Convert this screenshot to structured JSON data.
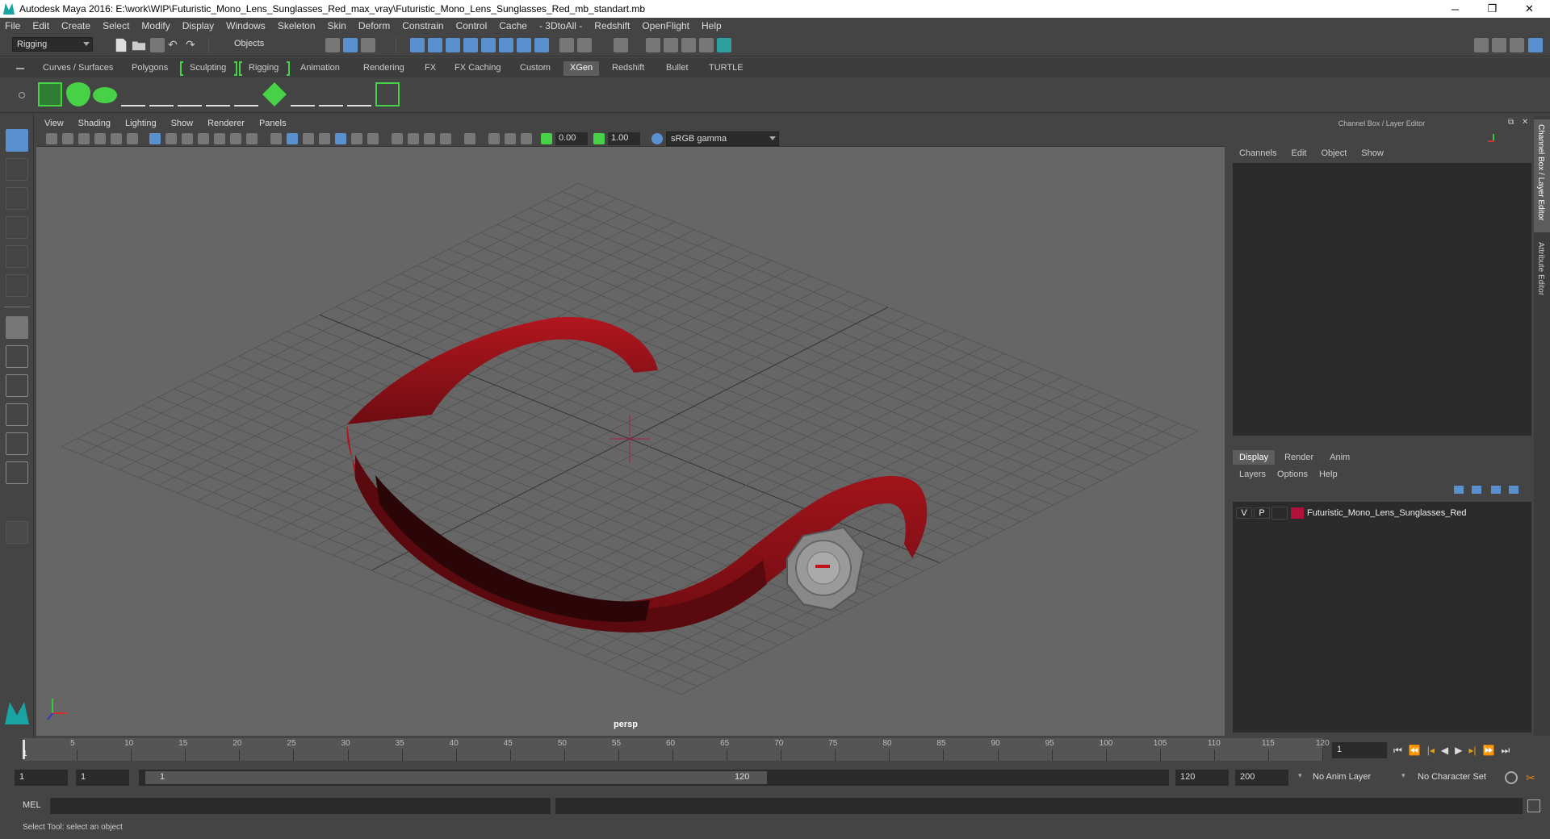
{
  "window": {
    "title": "Autodesk Maya 2016: E:\\work\\WIP\\Futuristic_Mono_Lens_Sunglasses_Red_max_vray\\Futuristic_Mono_Lens_Sunglasses_Red_mb_standart.mb",
    "minimize": "─",
    "restore": "❐",
    "close": "✕"
  },
  "menubar": [
    "File",
    "Edit",
    "Create",
    "Select",
    "Modify",
    "Display",
    "Windows",
    "Skeleton",
    "Skin",
    "Deform",
    "Constrain",
    "Control",
    "Cache",
    "- 3DtoAll -",
    "Redshift",
    "OpenFlight",
    "Help"
  ],
  "statusline": {
    "mode": "Rigging",
    "selection_mode": "Objects"
  },
  "shelf_tabs": [
    "Curves / Surfaces",
    "Polygons",
    "Sculpting",
    "Rigging",
    "Animation",
    "Rendering",
    "FX",
    "FX Caching",
    "Custom",
    "XGen",
    "Redshift",
    "Bullet",
    "TURTLE"
  ],
  "shelf_active_tab": "XGen",
  "viewport": {
    "menu": [
      "View",
      "Shading",
      "Lighting",
      "Show",
      "Renderer",
      "Panels"
    ],
    "exposure": "0.00",
    "gamma": "1.00",
    "color_space": "sRGB gamma",
    "camera_label": "persp"
  },
  "channel_box": {
    "title": "Channel Box / Layer Editor",
    "menu": [
      "Channels",
      "Edit",
      "Object",
      "Show"
    ]
  },
  "layer_editor": {
    "tabs": [
      "Display",
      "Render",
      "Anim"
    ],
    "active_tab": "Display",
    "menu": [
      "Layers",
      "Options",
      "Help"
    ],
    "layers": [
      {
        "v": "V",
        "p": "P",
        "name": "Futuristic_Mono_Lens_Sunglasses_Red",
        "color": "#b0123a"
      }
    ]
  },
  "side_tabs": [
    "Channel Box / Layer Editor",
    "Attribute Editor"
  ],
  "timeline": {
    "ticks": [
      "5",
      "10",
      "15",
      "20",
      "25",
      "30",
      "35",
      "40",
      "45",
      "50",
      "55",
      "60",
      "65",
      "70",
      "75",
      "80",
      "85",
      "90",
      "95",
      "100",
      "105",
      "110",
      "115",
      "120"
    ],
    "start_label": "1",
    "current_frame": "1"
  },
  "range": {
    "start": "1",
    "start2": "1",
    "slider_start": "1",
    "slider_end": "120",
    "end": "120",
    "end2": "200",
    "anim_layer": "No Anim Layer",
    "char_set": "No Character Set"
  },
  "command_line": {
    "label": "MEL"
  },
  "help_line": "Select Tool: select an object",
  "colors": {
    "model_red": "#8e1218",
    "accent_green": "#47d147",
    "accent_blue": "#5a8fd0"
  }
}
